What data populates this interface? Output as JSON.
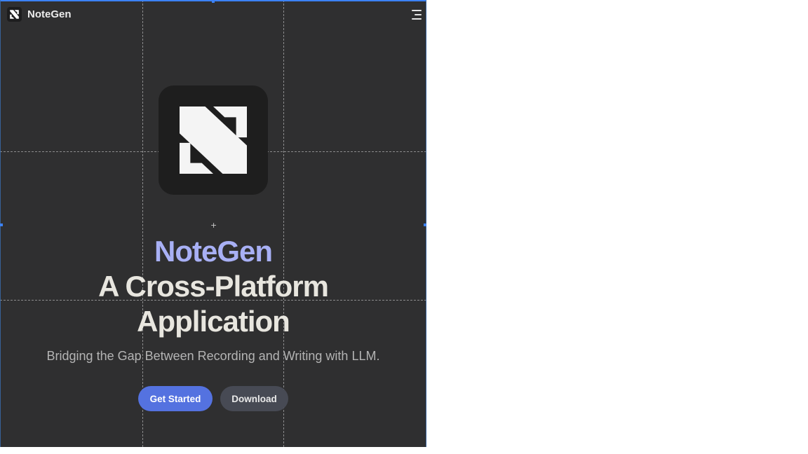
{
  "header": {
    "brand_name": "NoteGen",
    "brand_icon": "notegen-logo-icon",
    "menu_icon": "hamburger-menu-icon"
  },
  "hero": {
    "logo_icon": "notegen-logo-icon",
    "title_brand": "NoteGen",
    "title_line1": "A Cross-Platform",
    "title_line2": "Application",
    "subtitle": "Bridging the Gap Between Recording and Writing with LLM.",
    "primary_button_label": "Get Started",
    "secondary_button_label": "Download"
  },
  "colors": {
    "background": "#2f2f30",
    "title_accent": "#a8b0f5",
    "title_text": "#e8e6df",
    "primary_button": "#5472e0",
    "secondary_button": "#474a54",
    "selection_frame": "#3b82f6"
  }
}
